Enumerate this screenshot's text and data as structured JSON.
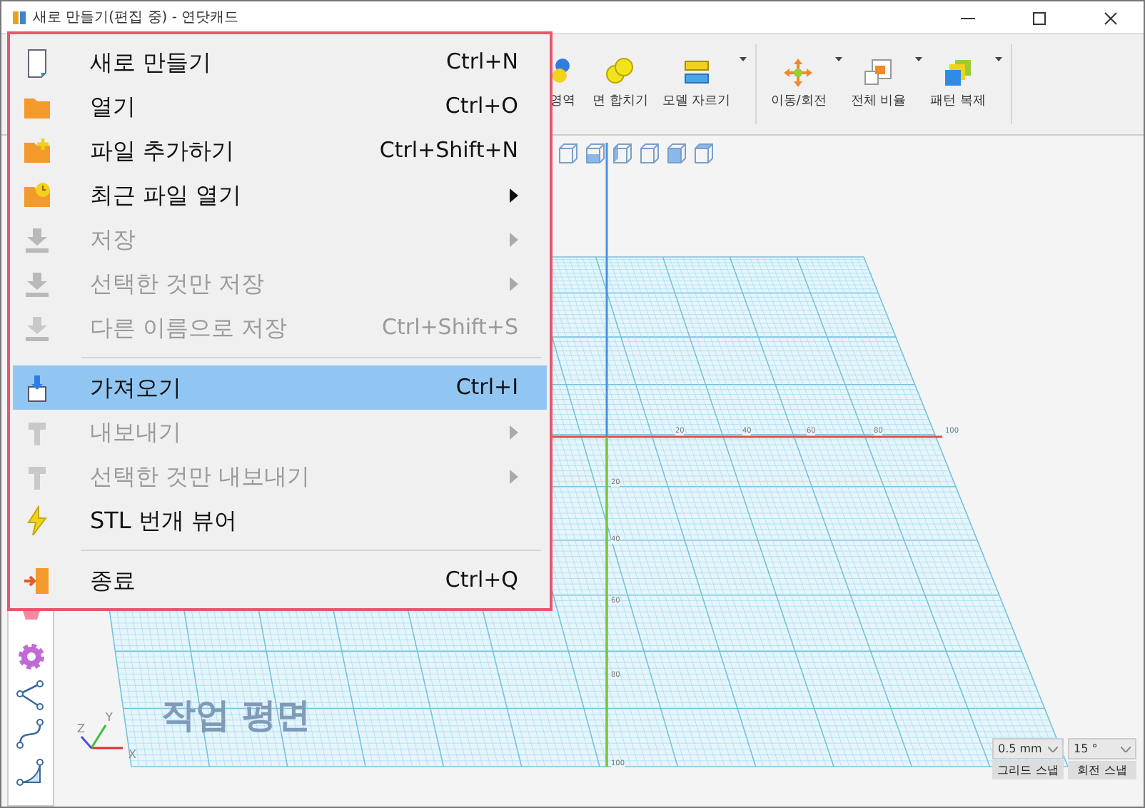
{
  "window": {
    "title": "새로 만들기(편집 중) - 연닷캐드"
  },
  "toolbar": [
    {
      "label": "영역",
      "has_dropdown": false
    },
    {
      "label": "면 합치기",
      "has_dropdown": false
    },
    {
      "label": "모델 자르기",
      "has_dropdown": true
    },
    {
      "label": "이동/회전",
      "has_dropdown": true
    },
    {
      "label": "전체 비율",
      "has_dropdown": true
    },
    {
      "label": "패턴 복제",
      "has_dropdown": true
    }
  ],
  "file_menu": [
    {
      "kind": "item",
      "label": "새로 만들기",
      "shortcut": "Ctrl+N",
      "submenu": false,
      "disabled": false,
      "selected": false
    },
    {
      "kind": "item",
      "label": "열기",
      "shortcut": "Ctrl+O",
      "submenu": false,
      "disabled": false,
      "selected": false
    },
    {
      "kind": "item",
      "label": "파일 추가하기",
      "shortcut": "Ctrl+Shift+N",
      "submenu": false,
      "disabled": false,
      "selected": false
    },
    {
      "kind": "item",
      "label": "최근 파일 열기",
      "submenu": true,
      "disabled": false,
      "selected": false
    },
    {
      "kind": "item",
      "label": "저장",
      "submenu": true,
      "disabled": true,
      "selected": false
    },
    {
      "kind": "item",
      "label": "선택한 것만 저장",
      "submenu": true,
      "disabled": true,
      "selected": false
    },
    {
      "kind": "item",
      "label": "다른 이름으로 저장",
      "shortcut": "Ctrl+Shift+S",
      "submenu": false,
      "disabled": true,
      "selected": false
    },
    {
      "kind": "separator"
    },
    {
      "kind": "item",
      "label": "가져오기",
      "shortcut": "Ctrl+I",
      "submenu": false,
      "disabled": false,
      "selected": true
    },
    {
      "kind": "item",
      "label": "내보내기",
      "submenu": true,
      "disabled": true,
      "selected": false
    },
    {
      "kind": "item",
      "label": "선택한 것만 내보내기",
      "submenu": true,
      "disabled": true,
      "selected": false
    },
    {
      "kind": "item",
      "label": "STL 번개 뷰어",
      "submenu": false,
      "disabled": false,
      "selected": false
    },
    {
      "kind": "separator"
    },
    {
      "kind": "item",
      "label": "종료",
      "shortcut": "Ctrl+Q",
      "submenu": false,
      "disabled": false,
      "selected": false
    }
  ],
  "viewport": {
    "plane_label": "작업 평면",
    "x_ticks": [
      "20",
      "40",
      "60",
      "80",
      "100"
    ],
    "y_ticks": [
      "20",
      "40",
      "60",
      "80",
      "100"
    ],
    "axes": [
      "X",
      "Y",
      "Z"
    ]
  },
  "snap": [
    {
      "value": "0.5 mm",
      "button": "그리드 스냅"
    },
    {
      "value": "15 °",
      "button": "회전 스냅"
    }
  ]
}
